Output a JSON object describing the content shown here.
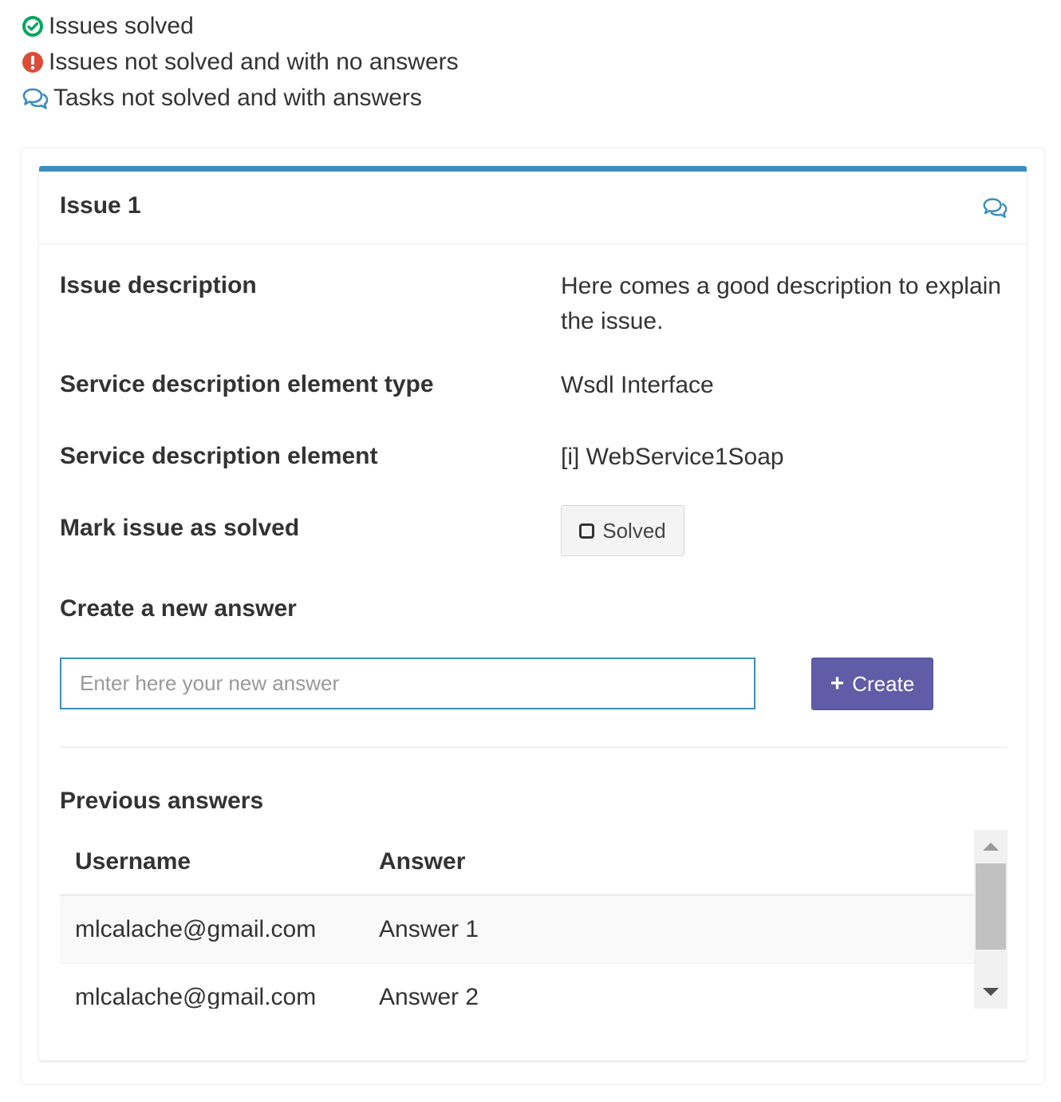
{
  "legend": {
    "solved": "Issues solved",
    "not_solved_no_answers": "Issues not solved and with no answers",
    "not_solved_with_answers": "Tasks not solved and with answers"
  },
  "colors": {
    "solved_icon": "#00a65a",
    "not_solved_icon": "#dd4b39",
    "comments_icon": "#3c8dbc",
    "box_top_border": "#3c8dbc",
    "create_button": "#605ca8"
  },
  "issue": {
    "title": "Issue 1",
    "status_icon": "comments-icon",
    "fields": {
      "description_label": "Issue description",
      "description_value": "Here comes a good description to explain the issue.",
      "element_type_label": "Service description element type",
      "element_type_value": "Wsdl Interface",
      "element_label": "Service description element",
      "element_value": "[i] WebService1Soap",
      "mark_solved_label": "Mark issue as solved"
    },
    "solved_button": "Solved",
    "new_answer": {
      "label": "Create a new answer",
      "placeholder": "Enter here your new answer",
      "value": "",
      "create_button": "Create"
    },
    "previous_answers": {
      "title": "Previous answers",
      "columns": [
        "Username",
        "Answer"
      ],
      "rows": [
        {
          "username": "mlcalache@gmail.com",
          "answer": "Answer 1"
        },
        {
          "username": "mlcalache@gmail.com",
          "answer": "Answer 2"
        }
      ]
    }
  }
}
